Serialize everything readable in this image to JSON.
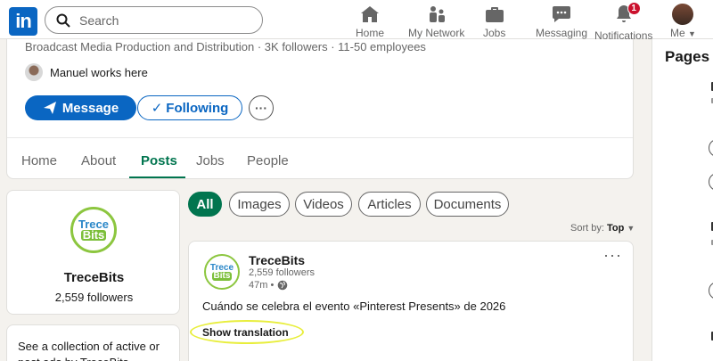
{
  "nav": {
    "logo_text": "in",
    "search_placeholder": "Search",
    "items": [
      {
        "label": "Home",
        "icon": "home-icon"
      },
      {
        "label": "My Network",
        "icon": "network-icon"
      },
      {
        "label": "Jobs",
        "icon": "briefcase-icon"
      },
      {
        "label": "Messaging",
        "icon": "message-icon"
      },
      {
        "label": "Notifications",
        "icon": "bell-icon",
        "badge": "1"
      },
      {
        "label": "Me",
        "icon": "avatar"
      }
    ]
  },
  "company": {
    "tagline": "Broadcast Media Production and Distribution · 3K followers · 11-50 employees",
    "works_here": "Manuel works here",
    "message_label": "Message",
    "following_label": "Following",
    "more_label": "···"
  },
  "tabs": [
    {
      "label": "Home",
      "active": false
    },
    {
      "label": "About",
      "active": false
    },
    {
      "label": "Posts",
      "active": true
    },
    {
      "label": "Jobs",
      "active": false
    },
    {
      "label": "People",
      "active": false
    }
  ],
  "sidebar": {
    "logo_line1": "Trece",
    "logo_line2": "Bits",
    "name": "TreceBits",
    "followers": "2,559 followers",
    "ads_text": "See a collection of active or past ads by TreceBits"
  },
  "filters": [
    "All",
    "Images",
    "Videos",
    "Articles",
    "Documents"
  ],
  "sort": {
    "label": "Sort by:",
    "value": "Top"
  },
  "post": {
    "author": "TreceBits",
    "followers": "2,559 followers",
    "time": "47m •",
    "menu": "···",
    "text": "Cuándo se celebra el evento «Pinterest Presents» de 2026",
    "translate_label": "Show translation"
  },
  "right_panel": {
    "title": "Pages p"
  },
  "colors": {
    "brand": "#0a66c2",
    "active_green": "#01754f",
    "highlight": "#e8ee3c"
  }
}
